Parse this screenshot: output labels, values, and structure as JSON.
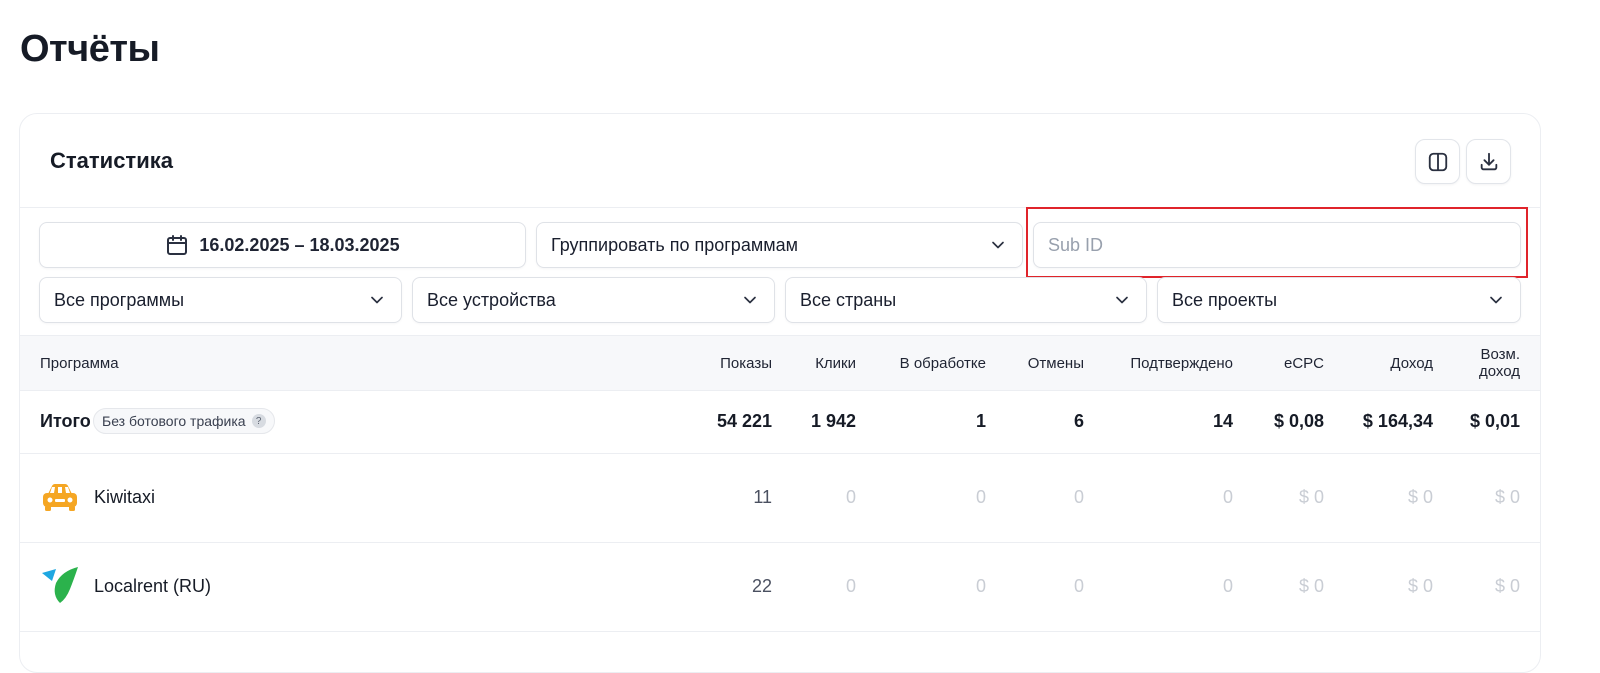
{
  "page": {
    "title": "Отчёты"
  },
  "card": {
    "title": "Статистика"
  },
  "toolbar": {
    "columns_icon": "columns-icon",
    "download_icon": "download-icon"
  },
  "filters": {
    "date_range": "16.02.2025 – 18.03.2025",
    "group_by": "Группировать по программам",
    "subid_placeholder": "Sub ID",
    "programs": "Все программы",
    "devices": "Все устройства",
    "countries": "Все страны",
    "projects": "Все проекты"
  },
  "table": {
    "headers": {
      "program": "Программа",
      "impressions": "Показы",
      "clicks": "Клики",
      "processing": "В обработке",
      "cancels": "Отмены",
      "confirmed": "Подтверждено",
      "ecpc": "eCPC",
      "income": "Доход",
      "refund_line1": "Возм.",
      "refund_line2": "доход"
    },
    "total": {
      "label": "Итого",
      "badge": "Без ботового трафика",
      "badge_hint": "?",
      "impressions": "54 221",
      "clicks": "1 942",
      "processing": "1",
      "cancels": "6",
      "confirmed": "14",
      "ecpc": "$ 0,08",
      "income": "$ 164,34",
      "refund": "$ 0,01"
    },
    "rows": [
      {
        "name": "Kiwitaxi",
        "icon": "taxi-car-icon",
        "impressions": "11",
        "clicks": "0",
        "processing": "0",
        "cancels": "0",
        "confirmed": "0",
        "ecpc": "$ 0",
        "income": "$ 0",
        "refund": "$ 0"
      },
      {
        "name": "Localrent (RU)",
        "icon": "localrent-logo-icon",
        "impressions": "22",
        "clicks": "0",
        "processing": "0",
        "cancels": "0",
        "confirmed": "0",
        "ecpc": "$ 0",
        "income": "$ 0",
        "refund": "$ 0"
      }
    ]
  },
  "colors": {
    "highlight": "#e0242b",
    "taxi": "#f5a623",
    "localrent_blue": "#1ea7e1",
    "localrent_green": "#2bb24c"
  }
}
